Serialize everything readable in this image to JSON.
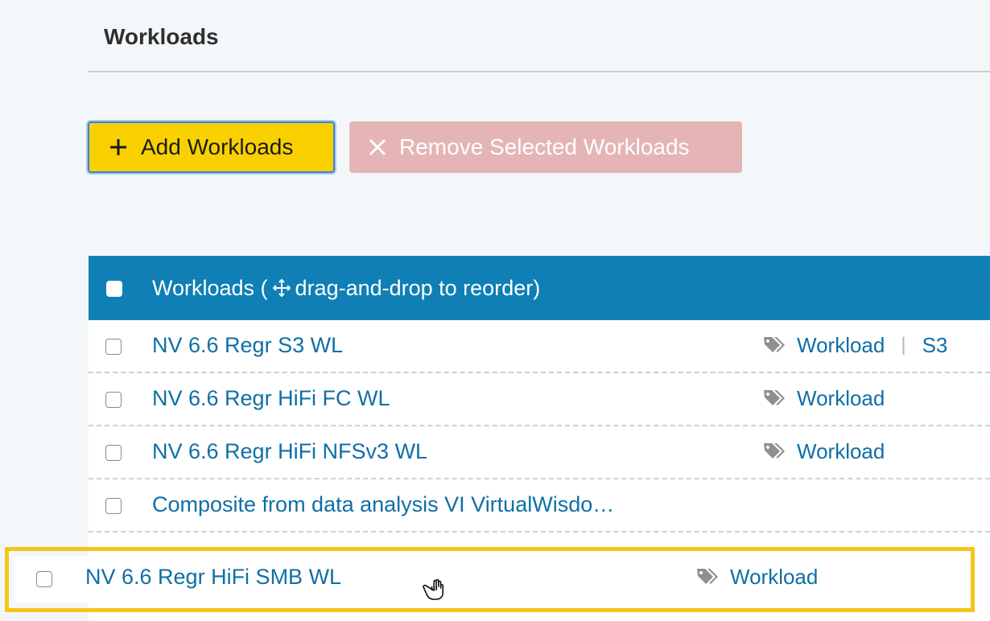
{
  "page": {
    "title": "Workloads"
  },
  "toolbar": {
    "add_label": "Add Workloads",
    "add_icon": "plus-icon",
    "remove_label": "Remove Selected Workloads",
    "remove_icon": "close-icon",
    "remove_disabled": true
  },
  "table": {
    "header_prefix": "Workloads (",
    "header_icon": "move-arrows-icon",
    "header_suffix": "drag-and-drop to reorder)",
    "rows": [
      {
        "title": "NV 6.6 Regr S3 WL",
        "tags": [
          "Workload",
          "S3"
        ]
      },
      {
        "title": "NV 6.6 Regr HiFi FC WL",
        "tags": [
          "Workload"
        ]
      },
      {
        "title": "NV 6.6 Regr HiFi NFSv3 WL",
        "tags": [
          "Workload"
        ]
      },
      {
        "title": "Composite from data analysis VI VirtualWisdo…",
        "tags": []
      }
    ],
    "dragged_row": {
      "title": "NV 6.6 Regr HiFi SMB WL",
      "tags": [
        "Workload"
      ]
    },
    "tag_separator": "|"
  },
  "colors": {
    "header_bg": "#0f7fb6",
    "link": "#0f6fa6",
    "add_button_bg": "#f9d100",
    "remove_button_bg": "#e5b5b5",
    "drag_highlight": "#f5c518"
  }
}
